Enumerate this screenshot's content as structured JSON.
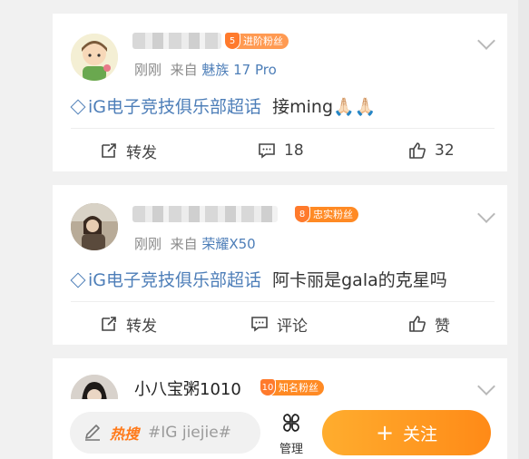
{
  "posts": [
    {
      "username": "",
      "badge_level": "5",
      "badge_label": "进阶粉丝",
      "time": "刚刚",
      "source_prefix": "来自",
      "device": "魅族 17 Pro",
      "topic": "iG电子竞技俱乐部超话",
      "text": "接ming🙏🏻🙏🏻",
      "repost_label": "转发",
      "comment_label": "18",
      "like_label": "32"
    },
    {
      "username": "",
      "badge_level": "8",
      "badge_label": "忠实粉丝",
      "time": "刚刚",
      "source_prefix": "来自",
      "device": "荣耀X50",
      "topic": "iG电子竞技俱乐部超话",
      "text": "阿卡丽是gala的克星吗",
      "repost_label": "转发",
      "comment_label": "评论",
      "like_label": "赞"
    },
    {
      "username": "小八宝粥1010",
      "badge_level": "10",
      "badge_label": "知名粉丝"
    }
  ],
  "bottom_bar": {
    "hot_label": "热搜",
    "search_text": "#IG jiejie#",
    "manage_label": "管理",
    "follow_label": "关注",
    "follow_icon": "+"
  },
  "colors": {
    "accent_orange": "#ff8a17",
    "link_blue": "#4d7eb8"
  }
}
